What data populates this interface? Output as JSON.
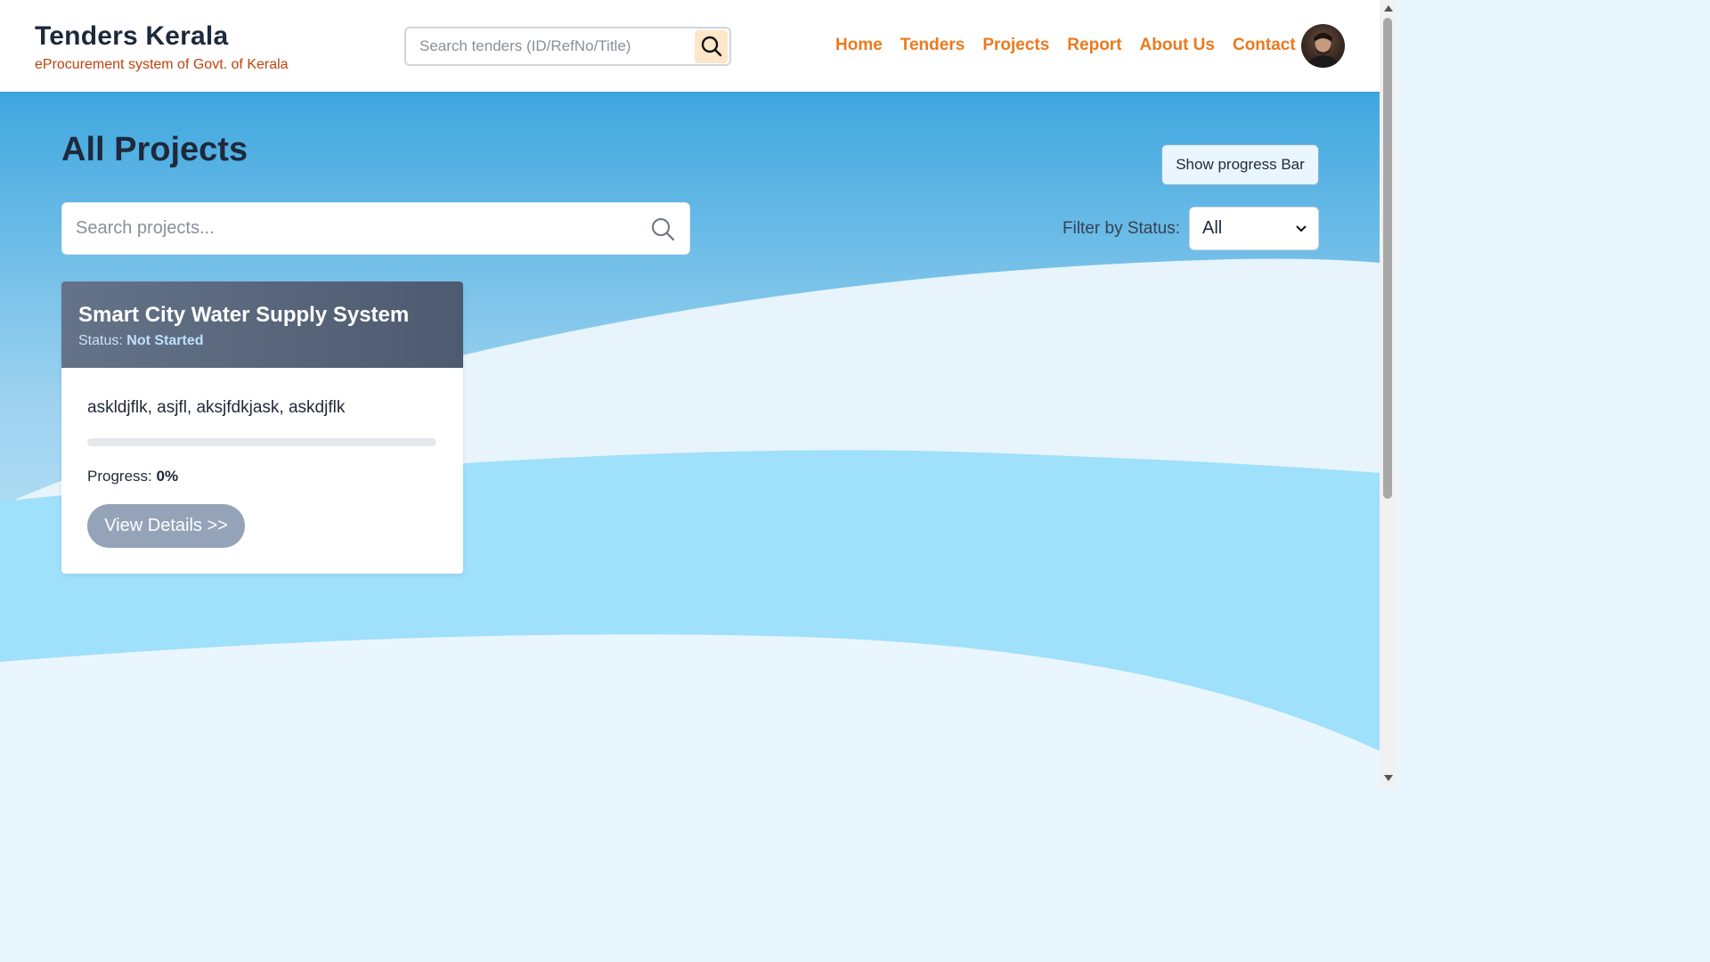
{
  "header": {
    "brand_title": "Tenders Kerala",
    "brand_subtitle": "eProcurement system of Govt. of Kerala",
    "search_placeholder": "Search tenders (ID/RefNo/Title)",
    "nav": [
      {
        "label": "Home"
      },
      {
        "label": "Tenders"
      },
      {
        "label": "Projects"
      },
      {
        "label": "Report"
      },
      {
        "label": "About Us"
      },
      {
        "label": "Contact"
      }
    ]
  },
  "main": {
    "title": "All Projects",
    "progress_toggle_label": "Show progress Bar",
    "search_placeholder": "Search projects...",
    "filter_label": "Filter by Status:",
    "filter_value": "All"
  },
  "projects": [
    {
      "title": "Smart City Water Supply System",
      "status_label": "Status:",
      "status": "Not Started",
      "description": "askldjflk, asjfl, aksjfdkjask, askdjflk",
      "progress_label": "Progress:",
      "progress_value": "0%",
      "progress_fraction": 0,
      "view_label": "View Details >>"
    }
  ],
  "colors": {
    "nav_accent": "#ea7a1e",
    "brand_subtitle": "#c2410c",
    "card_header": "#4d5a70",
    "view_button": "#94a3b8"
  },
  "icons": {
    "top_search": "search-icon",
    "project_search": "search-icon",
    "filter": "chevron-down-icon"
  }
}
